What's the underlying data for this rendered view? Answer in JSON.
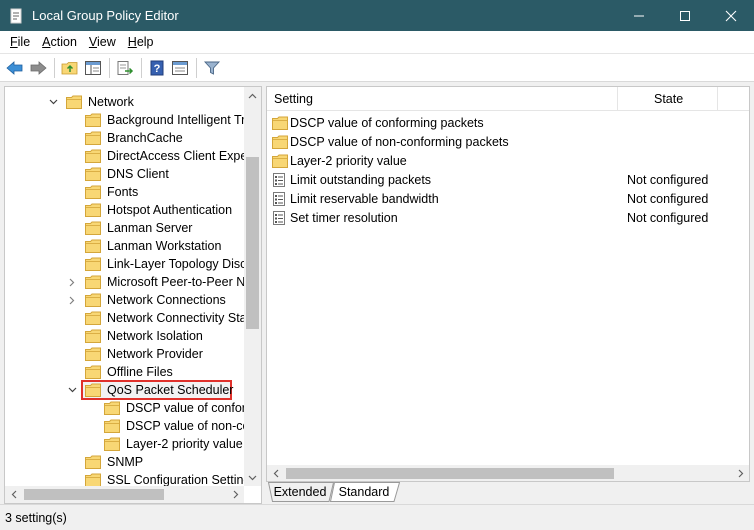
{
  "window": {
    "title": "Local Group Policy Editor"
  },
  "menu": [
    {
      "first": "F",
      "rest": "ile"
    },
    {
      "first": "A",
      "rest": "ction"
    },
    {
      "first": "V",
      "rest": "iew"
    },
    {
      "first": "H",
      "rest": "elp"
    }
  ],
  "toolbar": {
    "icons": [
      "back-arrow-icon",
      "forward-arrow-icon",
      "up-folder-icon",
      "show-hide-tree-icon",
      "export-list-icon",
      "help-icon",
      "properties-icon",
      "filter-icon"
    ]
  },
  "tree": {
    "items": [
      {
        "label": "Network",
        "depth": 0,
        "expander": "expanded"
      },
      {
        "label": "Background Intelligent Tra",
        "depth": 1,
        "expander": "none"
      },
      {
        "label": "BranchCache",
        "depth": 1,
        "expander": "none"
      },
      {
        "label": "DirectAccess Client Experi",
        "depth": 1,
        "expander": "none"
      },
      {
        "label": "DNS Client",
        "depth": 1,
        "expander": "none"
      },
      {
        "label": "Fonts",
        "depth": 1,
        "expander": "none"
      },
      {
        "label": "Hotspot Authentication",
        "depth": 1,
        "expander": "none"
      },
      {
        "label": "Lanman Server",
        "depth": 1,
        "expander": "none"
      },
      {
        "label": "Lanman Workstation",
        "depth": 1,
        "expander": "none"
      },
      {
        "label": "Link-Layer Topology Disco",
        "depth": 1,
        "expander": "none"
      },
      {
        "label": "Microsoft Peer-to-Peer Ne",
        "depth": 1,
        "expander": "collapsed"
      },
      {
        "label": "Network Connections",
        "depth": 1,
        "expander": "collapsed"
      },
      {
        "label": "Network Connectivity Stat",
        "depth": 1,
        "expander": "none"
      },
      {
        "label": "Network Isolation",
        "depth": 1,
        "expander": "none"
      },
      {
        "label": "Network Provider",
        "depth": 1,
        "expander": "none"
      },
      {
        "label": "Offline Files",
        "depth": 1,
        "expander": "none"
      },
      {
        "label": "QoS Packet Scheduler",
        "depth": 1,
        "expander": "expanded",
        "selected": true
      },
      {
        "label": "DSCP value of conform",
        "depth": 2,
        "expander": "none"
      },
      {
        "label": "DSCP value of non-co",
        "depth": 2,
        "expander": "none"
      },
      {
        "label": "Layer-2 priority value",
        "depth": 2,
        "expander": "none"
      },
      {
        "label": "SNMP",
        "depth": 1,
        "expander": "none"
      },
      {
        "label": "SSL Configuration Setting",
        "depth": 1,
        "expander": "none"
      }
    ]
  },
  "list": {
    "columns": {
      "setting": "Setting",
      "state": "State"
    },
    "rows": [
      {
        "type": "folder",
        "name": "DSCP value of conforming packets",
        "state": ""
      },
      {
        "type": "folder",
        "name": "DSCP value of non-conforming packets",
        "state": ""
      },
      {
        "type": "folder",
        "name": "Layer-2 priority value",
        "state": ""
      },
      {
        "type": "setting",
        "name": "Limit outstanding packets",
        "state": "Not configured"
      },
      {
        "type": "setting",
        "name": "Limit reservable bandwidth",
        "state": "Not configured"
      },
      {
        "type": "setting",
        "name": "Set timer resolution",
        "state": "Not configured"
      }
    ]
  },
  "tabs": [
    {
      "label": "Extended",
      "active": false
    },
    {
      "label": "Standard",
      "active": true
    }
  ],
  "status": {
    "text": "3 setting(s)"
  },
  "colors": {
    "titlebar": "#2b5a66",
    "selection_outline": "#e0312b",
    "folder_fill": "#f8d775",
    "folder_stroke": "#d4a63a"
  }
}
